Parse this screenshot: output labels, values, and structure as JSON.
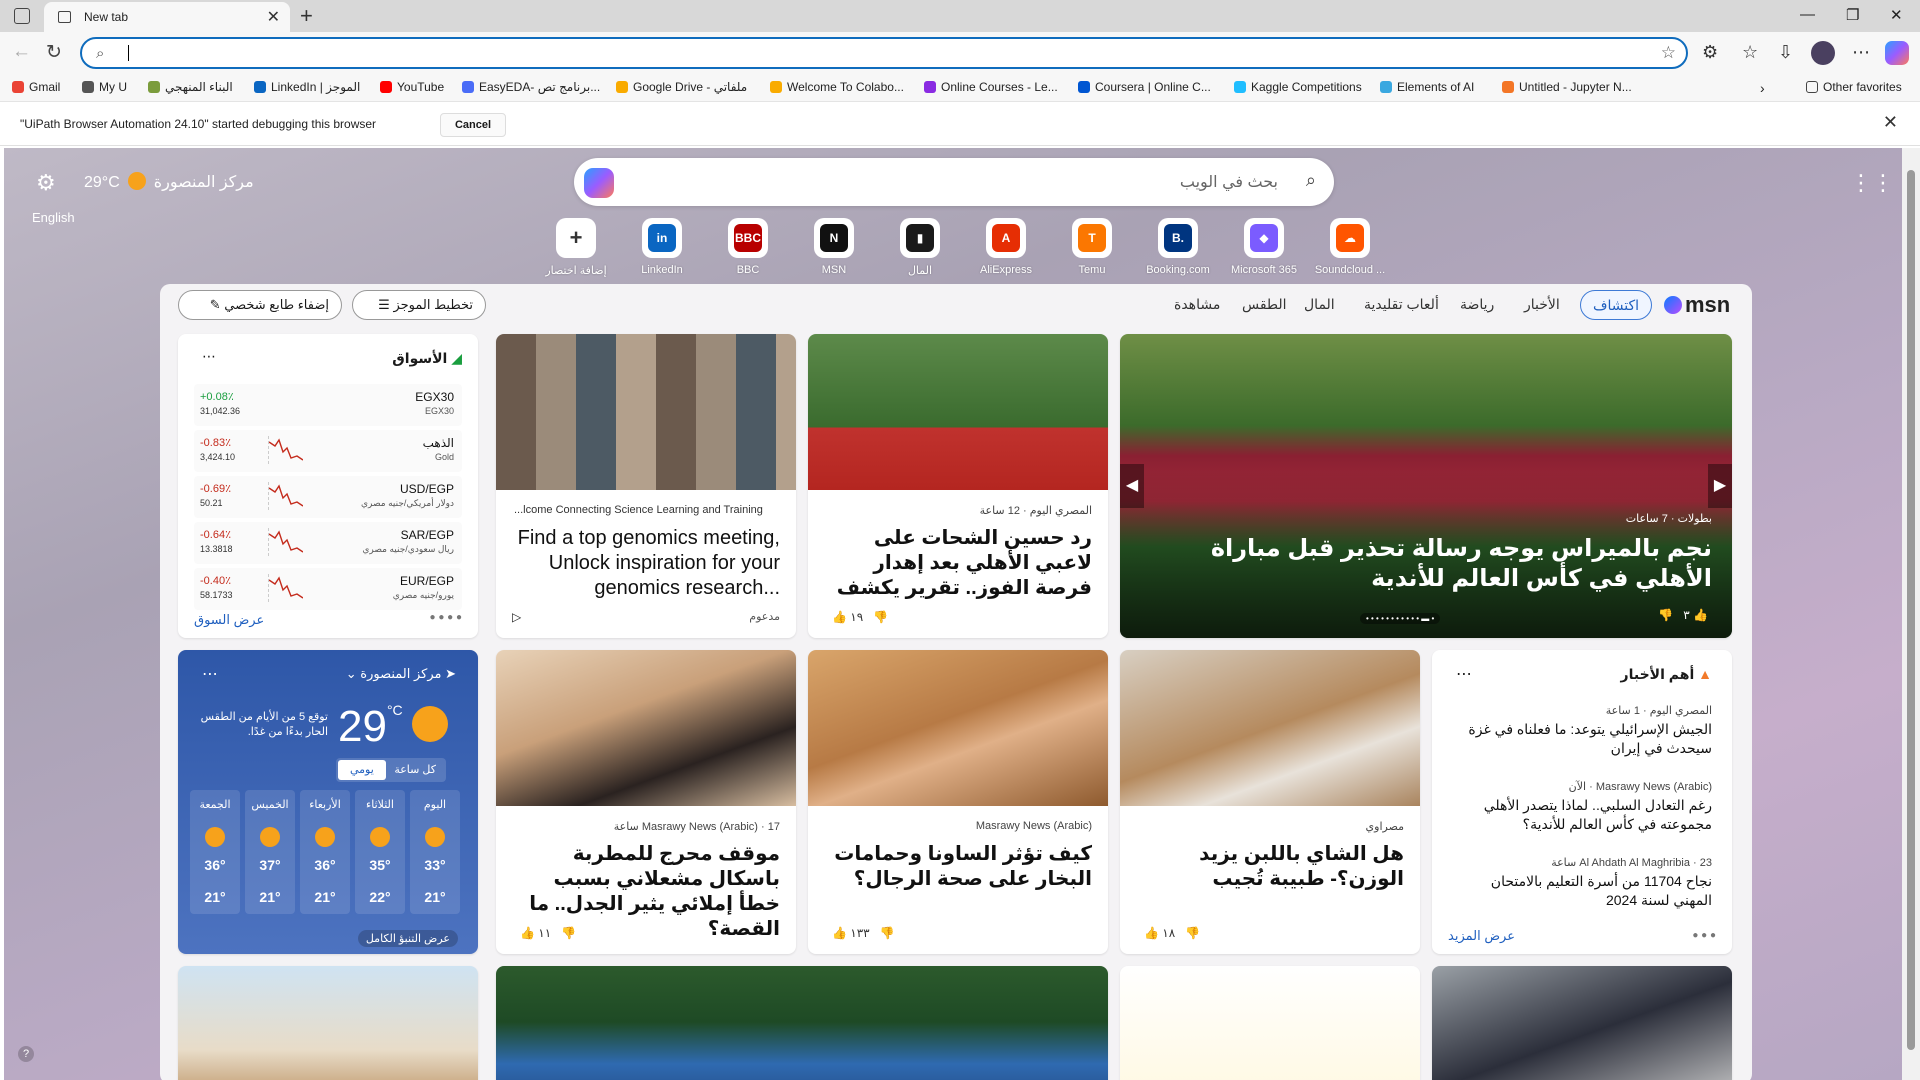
{
  "browser": {
    "tab_title": "New tab",
    "address_value": "",
    "favorites": [
      "Gmail",
      "My U",
      "البناء المنهجي",
      "LinkedIn | الموجز",
      "YouTube",
      "EasyEDA- برنامج تص...",
      "Google Drive - ملفاتي",
      "Welcome To Colabo...",
      "Online Courses - Le...",
      "Coursera | Online C...",
      "Kaggle Competitions",
      "Elements of AI",
      "Untitled - Jupyter N..."
    ],
    "other_favorites": "Other favorites",
    "infobar_message": "\"UiPath Browser Automation 24.10\" started debugging this browser",
    "infobar_cancel": "Cancel"
  },
  "top": {
    "language": "English",
    "temp": "29°C",
    "city": "مركز المنصورة",
    "search_placeholder": "بحث في الويب"
  },
  "quick_links": [
    {
      "label": "Soundcloud ...",
      "color": "#ff5500",
      "glyph": "☁"
    },
    {
      "label": "Microsoft 365",
      "color": "#7b5cff",
      "glyph": "◆"
    },
    {
      "label": "Booking.com",
      "color": "#003580",
      "glyph": "B."
    },
    {
      "label": "Temu",
      "color": "#fb7701",
      "glyph": "T"
    },
    {
      "label": "AliExpress",
      "color": "#e62e04",
      "glyph": "A"
    },
    {
      "label": "المال",
      "color": "#1a1a1a",
      "glyph": "▮"
    },
    {
      "label": "MSN",
      "color": "#111111",
      "glyph": "N"
    },
    {
      "label": "BBC",
      "color": "#b80000",
      "glyph": "BBC"
    },
    {
      "label": "LinkedIn",
      "color": "#0a66c2",
      "glyph": "in"
    },
    {
      "label": "إضافة اختصار",
      "color": "#ffffff",
      "glyph": "+"
    }
  ],
  "nav": {
    "tabs": [
      "اكتشاف",
      "الأخبار",
      "رياضة",
      "ألعاب تقليدية",
      "المال",
      "الطقس",
      "مشاهدة"
    ],
    "plan": "تخطيط الموجز",
    "personalize": "إضفاء طابع شخصي"
  },
  "hero": {
    "source": "بطولات",
    "time": "7 ساعات",
    "title": "نجم بالميراس يوجه رسالة تحذير قبل مباراة الأهلي في كأس العالم للأندية",
    "likes": "٣"
  },
  "card1": {
    "source": "المصري اليوم",
    "time": "12 ساعة",
    "title": "رد حسين الشحات على لاعبي الأهلي بعد إهدار فرصة الفوز.. تقرير يكشف",
    "likes": "١٩"
  },
  "card2": {
    "source": "...lcome Connecting Science Learning and Training",
    "title": "Find a top genomics meeting, Unlock inspiration for your genomics research...",
    "sponsored": "مدعوم"
  },
  "markets": {
    "title": "الأسواق",
    "more": "عرض السوق",
    "rows": [
      {
        "sym": "EGX30",
        "sub": "EGX30",
        "pct": "+0.08٪",
        "price": "31,042.36",
        "up": true
      },
      {
        "sym": "الذهب",
        "sub": "Gold",
        "pct": "-0.83٪",
        "price": "3,424.10",
        "up": false
      },
      {
        "sym": "USD/EGP",
        "sub": "دولار أمريكي/جنيه مصري",
        "pct": "-0.69٪",
        "price": "50.21",
        "up": false
      },
      {
        "sym": "SAR/EGP",
        "sub": "ريال سعودي/جنيه مصري",
        "pct": "-0.64٪",
        "price": "13.3818",
        "up": false
      },
      {
        "sym": "EUR/EGP",
        "sub": "يورو/جنيه مصري",
        "pct": "-0.40٪",
        "price": "58.1733",
        "up": false
      }
    ]
  },
  "weather": {
    "city": "مركز المنصورة",
    "temp": "29",
    "unit": "°C",
    "note": "توقع 5 من الأيام من الطقس الحار بدءًا من غدًا.",
    "tab_daily": "يومي",
    "tab_hourly": "كل ساعة",
    "full": "عرض التنبؤ الكامل",
    "days": [
      {
        "d": "اليوم",
        "hi": "33°",
        "lo": "21°"
      },
      {
        "d": "الثلاثاء",
        "hi": "35°",
        "lo": "22°"
      },
      {
        "d": "الأربعاء",
        "hi": "36°",
        "lo": "21°"
      },
      {
        "d": "الخميس",
        "hi": "37°",
        "lo": "21°"
      },
      {
        "d": "الجمعة",
        "hi": "36°",
        "lo": "21°"
      }
    ]
  },
  "card3": {
    "source": "Masrawy News (Arabic)",
    "time": "17 ساعة",
    "title": "موقف محرج للمطربة باسكال مشعلاني بسبب خطأ إملائي يثير الجدل.. ما القصة؟",
    "likes": "١١"
  },
  "card4": {
    "source": "Masrawy News (Arabic)",
    "title": "كيف تؤثر الساونا وحمامات البخار على صحة الرجال؟",
    "likes": "١٣٣"
  },
  "card5": {
    "source": "مصراوي",
    "title": "هل الشاي باللبن يزيد الوزن؟- طبيبة تُجيب",
    "likes": "١٨"
  },
  "topnews": {
    "title": "أهم الأخبار",
    "more": "عرض المزيد",
    "items": [
      {
        "src": "المصري اليوم",
        "time": "1 ساعة",
        "title": "الجيش الإسرائيلي يتوعد: ما فعلناه في غزة سيحدث في إيران"
      },
      {
        "src": "Masrawy News (Arabic)",
        "time": "الآن",
        "title": "رغم التعادل السلبي.. لماذا يتصدر الأهلي مجموعته في كأس العالم للأندية؟"
      },
      {
        "src": "Al Ahdath Al Maghribia",
        "time": "23 ساعة",
        "title": "نجاح 11704 من أسرة التعليم بالامتحان المهني لسنة 2024"
      }
    ]
  }
}
